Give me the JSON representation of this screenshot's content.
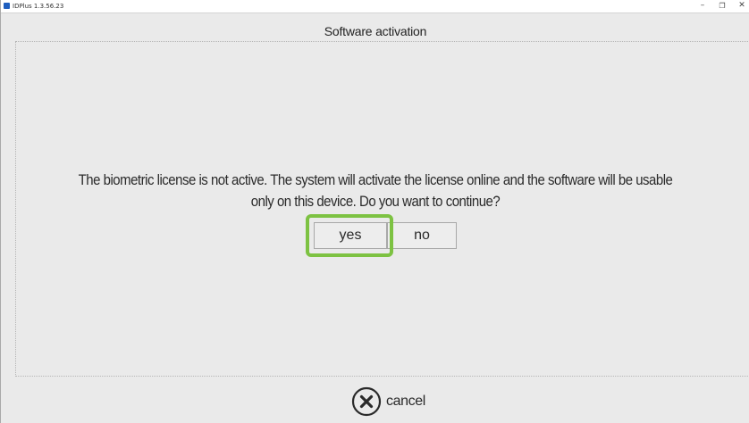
{
  "window": {
    "app_title": "IDPlus 1.3.56.23",
    "controls": {
      "minimize": "–",
      "maximize": "❐",
      "close": "✕"
    }
  },
  "dialog": {
    "title": "Software activation",
    "message_line1": "The biometric license is not active. The system will activate the license online and the software will be usable",
    "message_line2": "only on this device. Do you want to continue?",
    "yes_label": "yes",
    "no_label": "no",
    "highlight_color": "#7dc242"
  },
  "footer": {
    "cancel_label": "cancel",
    "cancel_icon": "close-circle-icon"
  }
}
